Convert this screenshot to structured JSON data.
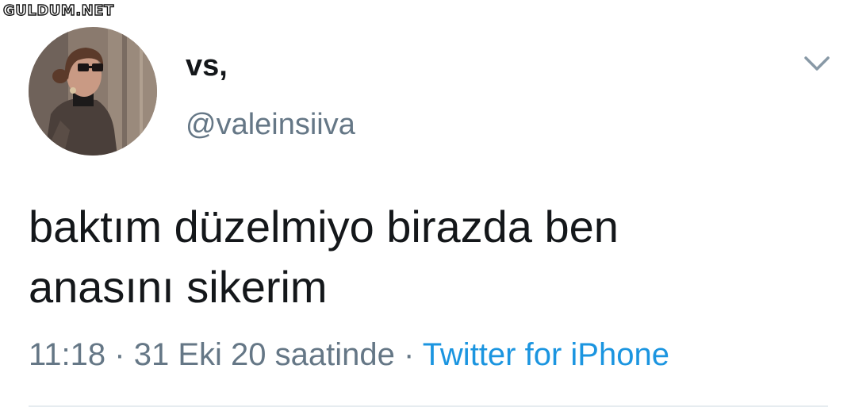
{
  "watermark": "GULDUM.NET",
  "tweet": {
    "display_name": "vs,",
    "handle": "@valeinsiiva",
    "text_line1": "baktım düzelmiyo birazda ben",
    "text_line2": "anasını sikerim",
    "time": "11:18",
    "date": "31 Eki 20 saatinde",
    "separator": "·",
    "source": "Twitter for iPhone"
  },
  "icons": {
    "menu": "chevron-down-icon",
    "avatar": "profile-photo"
  },
  "colors": {
    "text": "#14171a",
    "secondary": "#657786",
    "link": "#1b95e0",
    "divider": "#e6ecf0"
  }
}
